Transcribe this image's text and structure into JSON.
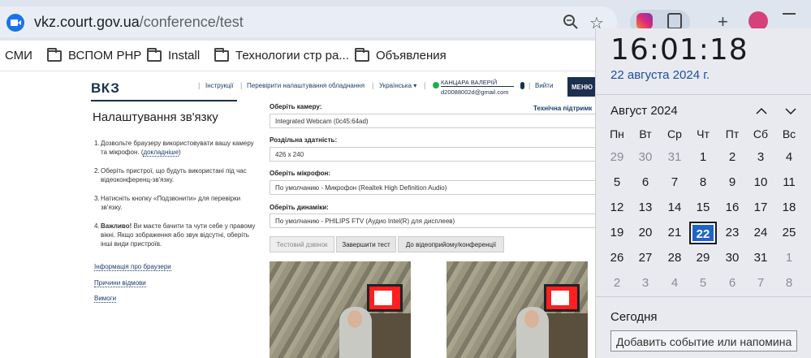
{
  "browser": {
    "url_host": "vkz.court.gov.ua",
    "url_path": "/conference/test"
  },
  "bookmarks": [
    {
      "label": "СМИ",
      "folder": false
    },
    {
      "label": "ВСПОМ PHP",
      "folder": true
    },
    {
      "label": "Install",
      "folder": true
    },
    {
      "label": "Технологии стр ра...",
      "folder": true
    },
    {
      "label": "Объявления",
      "folder": true
    }
  ],
  "site": {
    "logo": "ВКЗ",
    "nav": {
      "instructions": "Інструкції",
      "check_settings": "Перевірити налаштування обладнання",
      "language": "Українська ▾",
      "logout": "Вийти",
      "menu": "МЕНЮ"
    },
    "user": {
      "name": "КАНЦАРА ВАЛЕРІЙ",
      "email": "d20088002d@gmail.com"
    }
  },
  "settings": {
    "title": "Налаштування зв'язку",
    "steps": [
      {
        "num": "1.",
        "text": "Дозвольте браузеру використовувати вашу камеру та мікрофон. (",
        "link": "докладніше",
        "tail": ")"
      },
      {
        "num": "2.",
        "text": "Оберіть пристрої, що будуть використані під час відеоконференц-зв'язку."
      },
      {
        "num": "3.",
        "text": "Натисніть кнопку «Подзвонити» для перевірки зв'язку."
      },
      {
        "num": "4.",
        "bold": "Важливо!",
        "text": " Ви маєте бачити та чути себе у правому вікні. Якщо зображення або звук відсутні, оберіть інші види пристроїв."
      }
    ],
    "links": [
      "Інформація про браузери",
      "Причини відмови",
      "Вимоги"
    ],
    "tech_support": "Технічна підтримк",
    "camera_label": "Оберіть камеру:",
    "camera_value": "Integrated Webcam (0c45:64ad)",
    "resolution_label": "Роздільна здатність:",
    "resolution_value": "426 x 240",
    "mic_label": "Оберіть мікрофон:",
    "mic_value": "По умолчанию - Микрофон (Realtek High Definition Audio)",
    "speaker_label": "Оберіть динаміки:",
    "speaker_value": "По умолчанию - PHILIPS FTV (Аудио Intel(R) для дисплеев)",
    "buttons": {
      "test_call": "Тестовий дзвінок",
      "end_test": "Завершити тест",
      "to_conference": "До відеоприйому/конференції"
    }
  },
  "calendar": {
    "time": "16:01:18",
    "date": "22 августа 2024 г.",
    "month": "Август 2024",
    "weekdays": [
      "Пн",
      "Вт",
      "Ср",
      "Чт",
      "Пт",
      "Сб",
      "Вс"
    ],
    "weeks": [
      [
        "29",
        "30",
        "31",
        "1",
        "2",
        "3",
        "4"
      ],
      [
        "5",
        "6",
        "7",
        "8",
        "9",
        "10",
        "11"
      ],
      [
        "12",
        "13",
        "14",
        "15",
        "16",
        "17",
        "18"
      ],
      [
        "19",
        "20",
        "21",
        "22",
        "23",
        "24",
        "25"
      ],
      [
        "26",
        "27",
        "28",
        "29",
        "30",
        "31",
        "1"
      ],
      [
        "2",
        "3",
        "4",
        "5",
        "6",
        "7",
        "8"
      ]
    ],
    "today_label": "Сегодня",
    "event_placeholder": "Добавить событие или напомина"
  }
}
